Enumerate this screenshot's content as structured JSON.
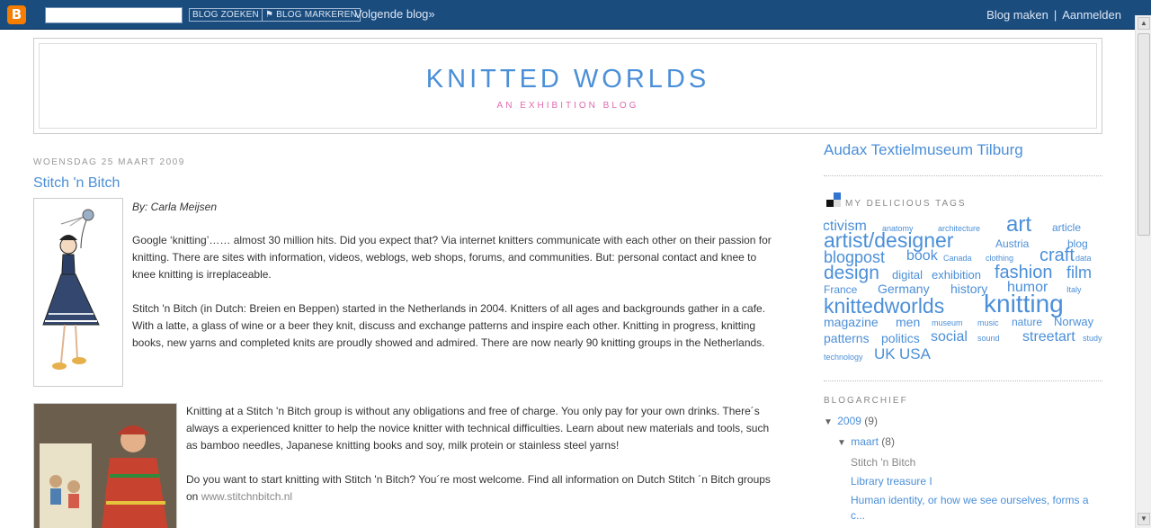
{
  "navbar": {
    "logo": "B",
    "search_btn": "BLOG ZOEKEN",
    "flag_btn": "BLOG MARKEREN",
    "next_blog": "Volgende blog»",
    "create_blog": "Blog maken",
    "separator": "|",
    "sign_in": "Aanmelden"
  },
  "header": {
    "title": "KNITTED WORLDS",
    "description": "AN EXHIBITION BLOG"
  },
  "post": {
    "date": "WOENSDAG 25 MAART 2009",
    "title": "Stitch 'n Bitch",
    "byline": "By: Carla Meijsen",
    "paragraph1": "Google ‘knitting’…… almost 30 million hits. Did you expect that? Via internet knitters communicate with each other on their passion for knitting. There are sites with information, videos, weblogs, web shops, forums, and communities. But: personal contact and knee to knee knitting is irreplaceable.",
    "paragraph2": "Stitch 'n Bitch (in Dutch: Breien en Beppen) started in the Netherlands in 2004. Knitters of all ages and backgrounds gather in a cafe. With a latte, a glass of wine or a beer they knit, discuss and exchange patterns and inspire each other. Knitting in progress, knitting books, new yarns and completed knits are proudly showed and admired. There are now nearly 90 knitting groups in the Netherlands.",
    "paragraph3": "Knitting at a Stitch 'n Bitch group is without any obligations and free of charge. You only pay for your own drinks. There´s always a experienced knitter to help the novice knitter with technical difficulties. Learn about new materials and tools, such as bamboo needles, Japanese knitting books and soy, milk protein or stainless steel yarns!",
    "paragraph4_text": "Do you want to start knitting with Stitch 'n Bitch? You´re most welcome. Find all information on Dutch Stitch ´n Bitch groups on ",
    "paragraph4_link": "www.stitchnbitch.nl"
  },
  "sidebar": {
    "museum": "Audax Textielmuseum Tilburg",
    "tags_heading": "MY DELICIOUS TAGS",
    "tags": [
      "activism",
      "anatomy",
      "architecture",
      "art",
      "article",
      "artist/designer",
      "Austria",
      "blog",
      "blogpost",
      "book",
      "Canada",
      "clothing",
      "craft",
      "data",
      "design",
      "digital",
      "exhibition",
      "fashion",
      "film",
      "France",
      "Germany",
      "history",
      "humor",
      "Italy",
      "knittedworlds",
      "knitting",
      "magazine",
      "men",
      "museum",
      "music",
      "nature",
      "Norway",
      "patterns",
      "politics",
      "social",
      "sound",
      "streetart",
      "study",
      "technology",
      "UK",
      "USA"
    ],
    "archive_heading": "BLOGARCHIEF",
    "archive_year": "2009",
    "archive_year_count": "(9)",
    "archive_month": "maart",
    "archive_month_count": "(8)",
    "posts": [
      "Stitch 'n Bitch",
      "Library treasure I",
      "Human identity, or how we see ourselves, forms a c..."
    ]
  },
  "colors": {
    "navbar": "#1b4c7e",
    "link": "#4b8fd8",
    "description": "#e06ab0"
  }
}
